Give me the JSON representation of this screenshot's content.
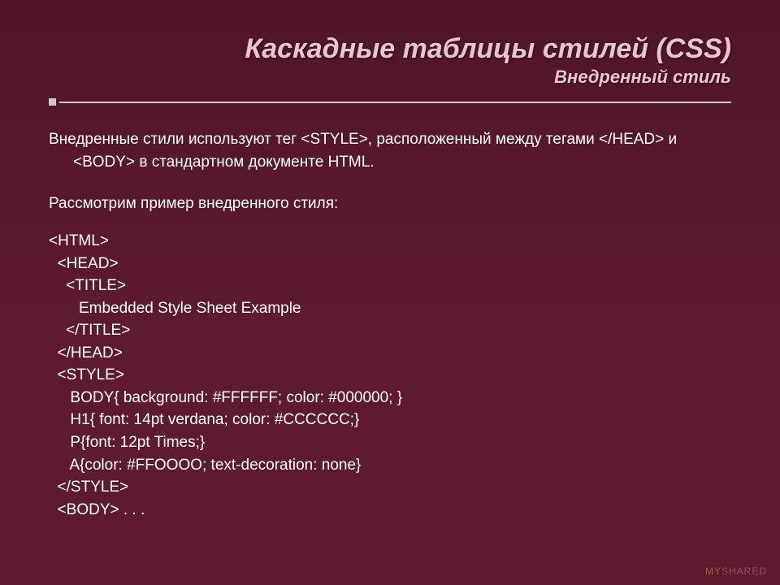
{
  "title": {
    "main": "Каскадные таблицы стилей (CSS)",
    "sub": "Внедренный стиль"
  },
  "body": {
    "para1": "Внедренные стили используют тег <STYLE>, расположенный между тегами </HEAD> и <BODY> в стандартном документе HTML.",
    "para2": "Рассмотрим пример внедреннoго стиля:",
    "code": "<HTML>\n  <HEAD>\n    <TITLE>\n       Embedded Style Sheet Example\n    </TITLE>\n  </HEAD>\n  <STYLE>\n     BODY{ background: #FFFFFF; color: #000000; }\n     H1{ font: 14pt verdana; color: #CCCCCC;}\n     P{font: 12pt Times;}\n     A{color: #FFOOOO; text-decoration: none}\n  </STYLE>\n  <BODY> . . ."
  },
  "watermark": {
    "prefix": "MY",
    "suffix": "SHARED"
  }
}
